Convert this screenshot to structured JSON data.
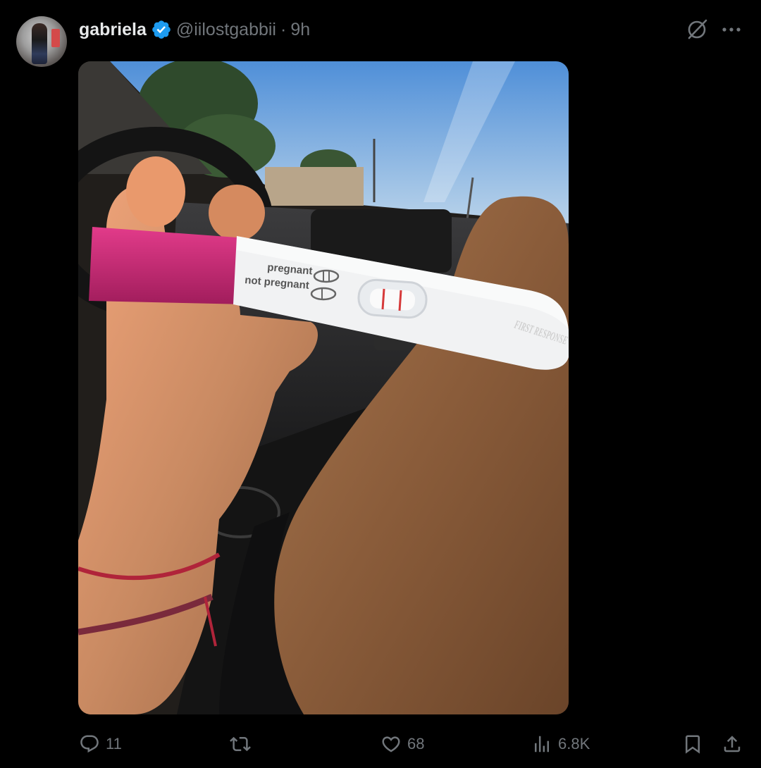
{
  "tweet": {
    "author_name": "gabriela",
    "handle": "@iilostgabbii",
    "separator": "·",
    "time": "9h",
    "media": {
      "test_label_pregnant": "pregnant",
      "test_label_not_pregnant": "not pregnant",
      "brand_text": "FIRST RESPONSE"
    },
    "stats": {
      "replies": "11",
      "reposts": "",
      "likes": "68",
      "views": "6.8K"
    }
  },
  "colors": {
    "background": "#000000",
    "text_primary": "#e7e9ea",
    "text_secondary": "#71767b",
    "verified": "#1d9bf0"
  },
  "icons": {
    "verified": "verified-badge-icon",
    "grok": "grok-icon",
    "more": "more-icon",
    "reply": "reply-icon",
    "repost": "repost-icon",
    "like": "heart-icon",
    "views": "analytics-icon",
    "bookmark": "bookmark-icon",
    "share": "share-icon"
  }
}
